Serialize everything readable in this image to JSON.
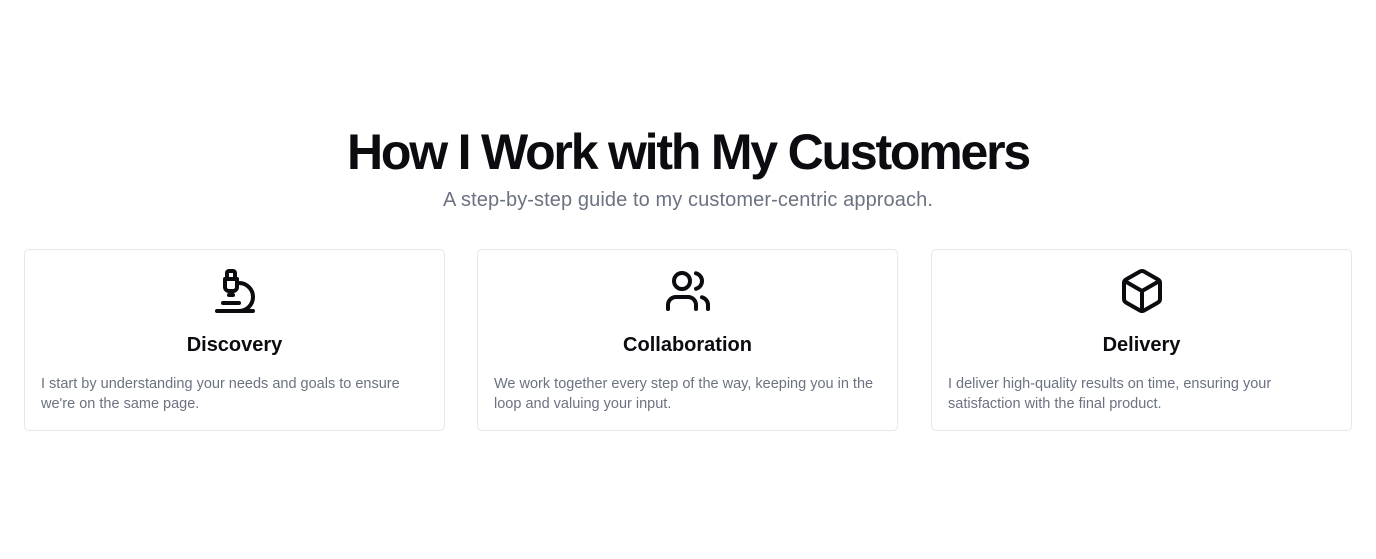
{
  "header": {
    "title": "How I Work with My Customers",
    "subtitle": "A step-by-step guide to my customer-centric approach."
  },
  "cards": [
    {
      "icon": "microscope-icon",
      "title": "Discovery",
      "description": "I start by understanding your needs and goals to ensure we're on the same page."
    },
    {
      "icon": "users-icon",
      "title": "Collaboration",
      "description": "We work together every step of the way, keeping you in the loop and valuing your input."
    },
    {
      "icon": "package-icon",
      "title": "Delivery",
      "description": "I deliver high-quality results on time, ensuring your satisfaction with the final product."
    }
  ],
  "colors": {
    "heading": "#0b0b10",
    "muted_text": "#6b7280",
    "card_border": "#e5e7eb",
    "background": "#ffffff",
    "icon_stroke": "#0b0b10"
  }
}
